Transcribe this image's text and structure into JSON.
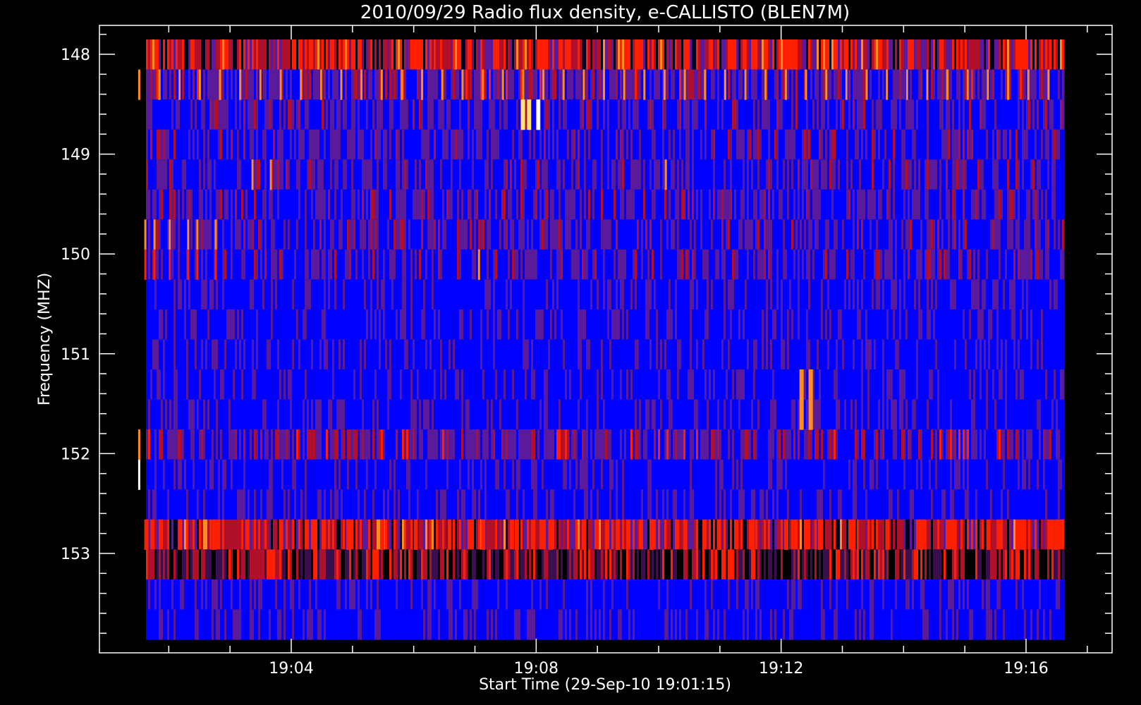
{
  "chart_data": {
    "type": "heatmap",
    "title": "2010/09/29  Radio flux density, e-CALLISTO (BLEN7M)",
    "xlabel": "Start Time (29-Sep-10 19:01:15)",
    "ylabel": "Frequency (MHZ)",
    "x_ticks": [
      "19:04",
      "19:08",
      "19:12",
      "19:16"
    ],
    "y_ticks": [
      "148",
      "149",
      "150",
      "151",
      "152",
      "153"
    ],
    "x_range_minutes": [
      19.0,
      19.29
    ],
    "y_range_mhz": [
      147.75,
      154.0
    ],
    "start_time": "19:01:15",
    "end_time": "19:16:40",
    "colors": {
      "background": "#000000",
      "base": "#0000ff",
      "dim": "#5a1a9a",
      "mid": "#b0102a",
      "hot": "#ff2000",
      "hotter": "#ff8c20",
      "hottest": "#ffe070",
      "max": "#ffffff",
      "axes": "#ffffff"
    },
    "channels": [
      {
        "mhz": 148.0,
        "intensity": "high-variable"
      },
      {
        "mhz": 148.3,
        "intensity": "moderate-orange-spikes"
      },
      {
        "mhz": 148.6,
        "intensity": "low-with-burst-19:07:45"
      },
      {
        "mhz": 148.9,
        "intensity": "low"
      },
      {
        "mhz": 149.2,
        "intensity": "low-red-spikes"
      },
      {
        "mhz": 149.5,
        "intensity": "low-red-spikes"
      },
      {
        "mhz": 149.8,
        "intensity": "low-burst-19:01:30"
      },
      {
        "mhz": 150.1,
        "intensity": "low-red-spikes"
      },
      {
        "mhz": 150.4,
        "intensity": "base"
      },
      {
        "mhz": 150.7,
        "intensity": "base"
      },
      {
        "mhz": 151.0,
        "intensity": "base"
      },
      {
        "mhz": 151.3,
        "intensity": "burst-19:12:20"
      },
      {
        "mhz": 151.6,
        "intensity": "base"
      },
      {
        "mhz": 151.9,
        "intensity": "moderate"
      },
      {
        "mhz": 152.2,
        "intensity": "base-white-at-start"
      },
      {
        "mhz": 152.5,
        "intensity": "base"
      },
      {
        "mhz": 152.8,
        "intensity": "high-red"
      },
      {
        "mhz": 153.1,
        "intensity": "high-dark"
      },
      {
        "mhz": 153.4,
        "intensity": "base"
      },
      {
        "mhz": 153.7,
        "intensity": "base"
      }
    ]
  }
}
